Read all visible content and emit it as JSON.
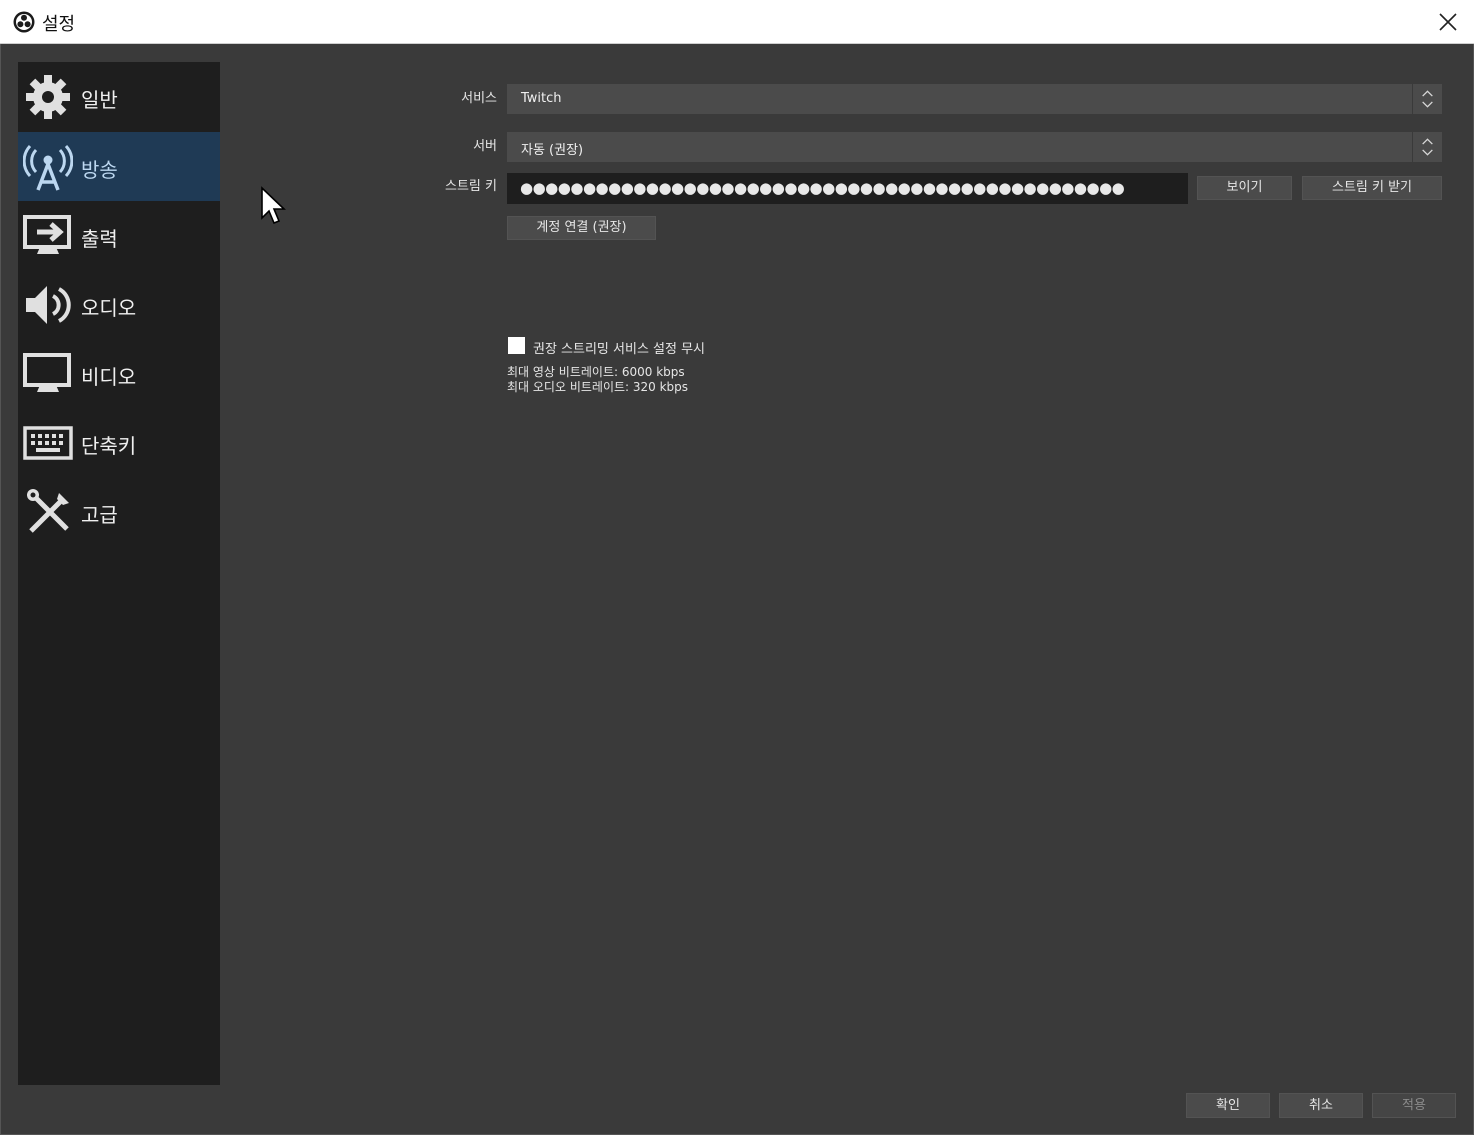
{
  "window": {
    "title": "설정",
    "logo_icon": "obs-logo-icon",
    "close_icon": "close-icon"
  },
  "sidebar": {
    "items": [
      {
        "label": "일반",
        "icon": "gear-icon",
        "active": false
      },
      {
        "label": "방송",
        "icon": "broadcast-tower-icon",
        "active": true
      },
      {
        "label": "출력",
        "icon": "output-monitor-icon",
        "active": false
      },
      {
        "label": "오디오",
        "icon": "speaker-icon",
        "active": false
      },
      {
        "label": "비디오",
        "icon": "monitor-icon",
        "active": false
      },
      {
        "label": "단축키",
        "icon": "keyboard-icon",
        "active": false
      },
      {
        "label": "고급",
        "icon": "tools-icon",
        "active": false
      }
    ]
  },
  "stream": {
    "service_label": "서비스",
    "service_value": "Twitch",
    "server_label": "서버",
    "server_value": "자동 (권장)",
    "key_label": "스트림 키",
    "key_masked": "●●●●●●●●●●●●●●●●●●●●●●●●●●●●●●●●●●●●●●●●●●●●●●●●",
    "show_button": "보이기",
    "get_key_button": "스트림 키 받기",
    "connect_account_button": "계정 연결 (권장)",
    "ignore_recommended_label": "권장 스트리밍 서비스 설정 무시",
    "ignore_recommended_checked": false,
    "max_video_bitrate": "최대 영상 비트레이트: 6000 kbps",
    "max_audio_bitrate": "최대 오디오 비트레이트: 320 kbps"
  },
  "footer": {
    "ok": "확인",
    "cancel": "취소",
    "apply": "적용"
  },
  "colors": {
    "background": "#3a3a3a",
    "sidebar": "#1e1e1e",
    "active_item": "#1f3a55",
    "input": "#4b4b4b",
    "key_field": "#1e1e1e"
  }
}
